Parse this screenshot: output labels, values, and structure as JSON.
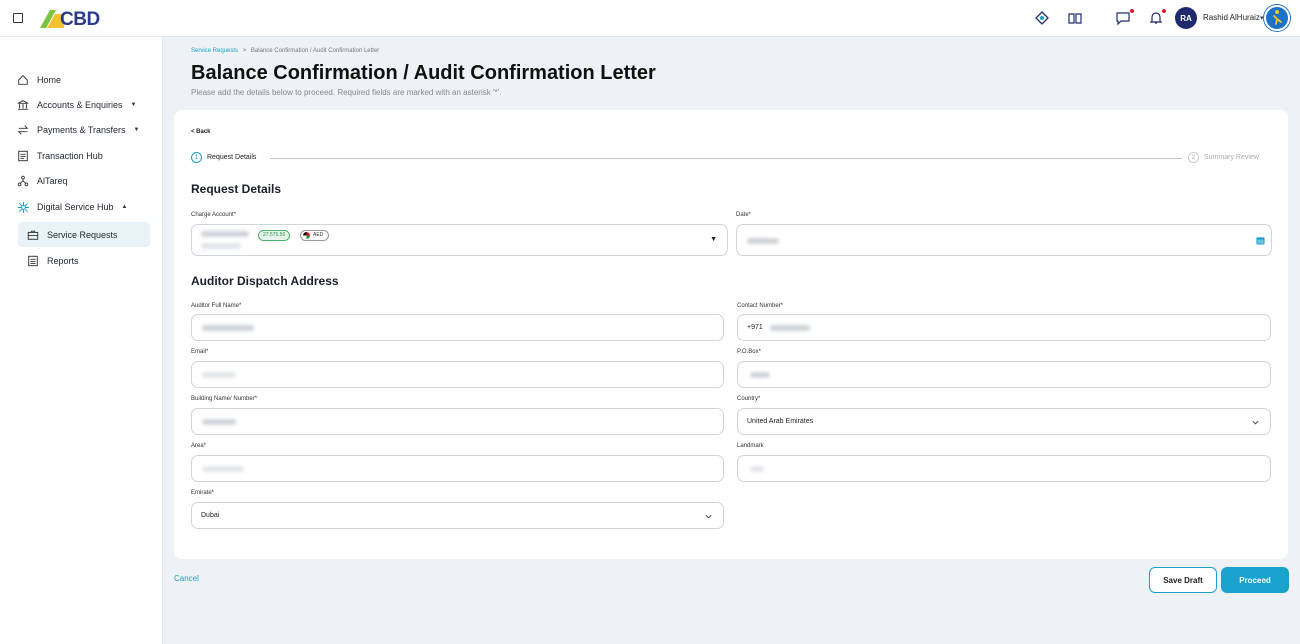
{
  "topbar": {
    "logo_text": "CBD",
    "user_initials": "RA",
    "user_name": "Rashid AlHuraiz"
  },
  "sidebar": {
    "items": [
      {
        "label": "Home"
      },
      {
        "label": "Accounts & Enquiries"
      },
      {
        "label": "Payments & Transfers"
      },
      {
        "label": "Transaction Hub"
      },
      {
        "label": "AlTareq"
      },
      {
        "label": "Digital Service Hub"
      },
      {
        "label": "Service Requests"
      },
      {
        "label": "Reports"
      }
    ]
  },
  "breadcrumb": {
    "parent": "Service Requests",
    "separator": ">",
    "current": "Balance Confirmation / Audit Confirmation Letter"
  },
  "page": {
    "title": "Balance Confirmation / Audit Confirmation Letter",
    "subtitle": "Please add the details below to proceed. Required fields are marked with an asterisk '*'."
  },
  "back_label": "< Back",
  "stepper": {
    "steps": [
      {
        "number": "1",
        "label": "Request Details"
      },
      {
        "number": "2",
        "label": "Summary Review"
      }
    ]
  },
  "request_details": {
    "title": "Request Details",
    "charge_account_label": "Charge Account*",
    "charge_account_amount": "27,575.56",
    "charge_account_currency": "AED",
    "date_label": "Date*"
  },
  "auditor": {
    "title": "Auditor Dispatch Address",
    "full_name_label": "Auditor Full Name*",
    "contact_label": "Contact Number*",
    "contact_prefix": "+971",
    "email_label": "Email*",
    "pobox_label": "P.O.Box*",
    "building_label": "Building Name/ Number*",
    "country_label": "Country*",
    "country_value": "United Arab Emirates",
    "area_label": "Area*",
    "landmark_label": "Landmark",
    "emirate_label": "Emirate*",
    "emirate_value": "Dubai"
  },
  "actions": {
    "cancel": "Cancel",
    "save_draft": "Save Draft",
    "proceed": "Proceed"
  },
  "colors": {
    "accent": "#18a2cd",
    "brand_navy": "#1e2a6b",
    "positive": "#2c8a46"
  }
}
